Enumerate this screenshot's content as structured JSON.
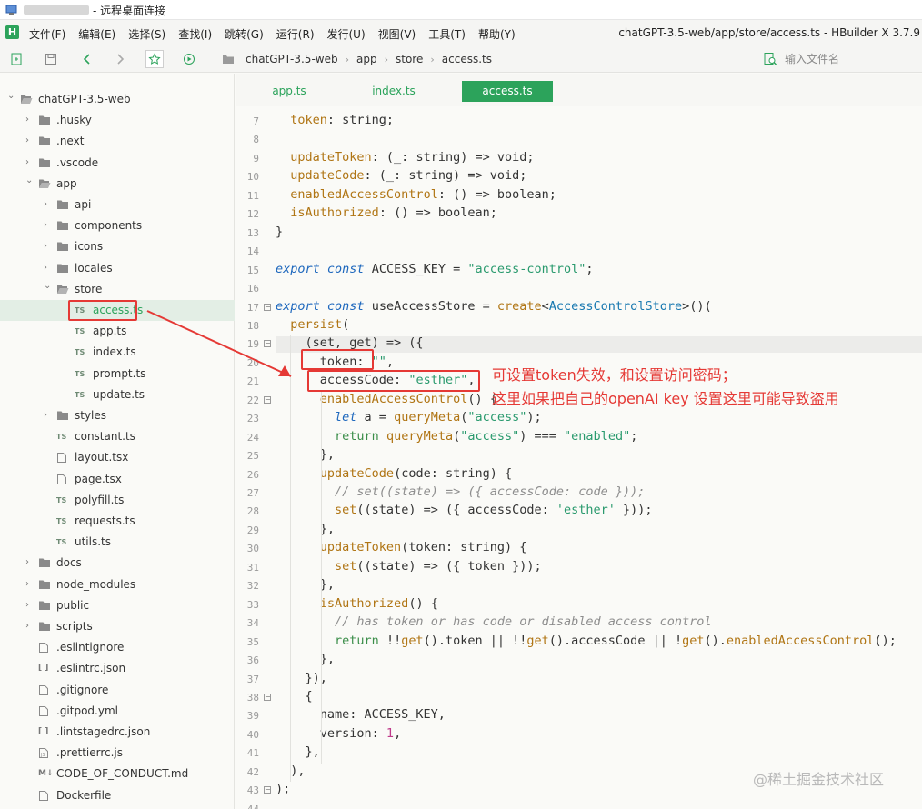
{
  "titlebar": {
    "title": "- 远程桌面连接"
  },
  "menubar": {
    "items": [
      "文件(F)",
      "编辑(E)",
      "选择(S)",
      "查找(I)",
      "跳转(G)",
      "运行(R)",
      "发行(U)",
      "视图(V)",
      "工具(T)",
      "帮助(Y)"
    ],
    "window_title": "chatGPT-3.5-web/app/store/access.ts - HBuilder X 3.7.9"
  },
  "toolbar": {
    "breadcrumb": [
      "chatGPT-3.5-web",
      "app",
      "store",
      "access.ts"
    ],
    "file_search_placeholder": "输入文件名"
  },
  "sidebar": {
    "items": [
      {
        "label": "chatGPT-3.5-web",
        "kind": "root",
        "icon": "folder-open-icon"
      },
      {
        "label": ".husky",
        "kind": "folder",
        "icon": "folder-icon"
      },
      {
        "label": ".next",
        "kind": "folder",
        "icon": "folder-icon"
      },
      {
        "label": ".vscode",
        "kind": "folder",
        "icon": "folder-icon"
      },
      {
        "label": "app",
        "kind": "folder-open",
        "icon": "folder-open-icon"
      },
      {
        "label": "api",
        "kind": "folder",
        "icon": "folder-icon"
      },
      {
        "label": "components",
        "kind": "folder",
        "icon": "folder-icon"
      },
      {
        "label": "icons",
        "kind": "folder",
        "icon": "folder-icon"
      },
      {
        "label": "locales",
        "kind": "folder",
        "icon": "folder-icon"
      },
      {
        "label": "store",
        "kind": "folder-open",
        "icon": "folder-open-icon"
      },
      {
        "label": "access.ts",
        "kind": "ts",
        "icon": "typescript-file-icon",
        "selected": true
      },
      {
        "label": "app.ts",
        "kind": "ts",
        "icon": "typescript-file-icon"
      },
      {
        "label": "index.ts",
        "kind": "ts",
        "icon": "typescript-file-icon"
      },
      {
        "label": "prompt.ts",
        "kind": "ts",
        "icon": "typescript-file-icon"
      },
      {
        "label": "update.ts",
        "kind": "ts",
        "icon": "typescript-file-icon"
      },
      {
        "label": "styles",
        "kind": "folder",
        "icon": "folder-icon"
      },
      {
        "label": "constant.ts",
        "kind": "ts",
        "icon": "typescript-file-icon"
      },
      {
        "label": "layout.tsx",
        "kind": "file",
        "icon": "file-icon"
      },
      {
        "label": "page.tsx",
        "kind": "file",
        "icon": "file-icon"
      },
      {
        "label": "polyfill.ts",
        "kind": "ts",
        "icon": "typescript-file-icon"
      },
      {
        "label": "requests.ts",
        "kind": "ts",
        "icon": "typescript-file-icon"
      },
      {
        "label": "utils.ts",
        "kind": "ts",
        "icon": "typescript-file-icon"
      },
      {
        "label": "docs",
        "kind": "folder",
        "icon": "folder-icon"
      },
      {
        "label": "node_modules",
        "kind": "folder",
        "icon": "folder-icon"
      },
      {
        "label": "public",
        "kind": "folder",
        "icon": "folder-icon"
      },
      {
        "label": "scripts",
        "kind": "folder",
        "icon": "folder-icon"
      },
      {
        "label": ".eslintignore",
        "kind": "file",
        "icon": "file-icon"
      },
      {
        "label": ".eslintrc.json",
        "kind": "json",
        "icon": "json-file-icon"
      },
      {
        "label": ".gitignore",
        "kind": "file",
        "icon": "file-icon"
      },
      {
        "label": ".gitpod.yml",
        "kind": "file",
        "icon": "file-icon"
      },
      {
        "label": ".lintstagedrc.json",
        "kind": "json",
        "icon": "json-file-icon"
      },
      {
        "label": ".prettierrc.js",
        "kind": "js",
        "icon": "js-file-icon"
      },
      {
        "label": "CODE_OF_CONDUCT.md",
        "kind": "md",
        "icon": "markdown-file-icon"
      },
      {
        "label": "Dockerfile",
        "kind": "file",
        "icon": "file-icon"
      }
    ]
  },
  "tabs": [
    {
      "label": "app.ts",
      "active": false
    },
    {
      "label": "index.ts",
      "active": false
    },
    {
      "label": "access.ts",
      "active": true
    }
  ],
  "editor": {
    "lines": [
      {
        "n": "7",
        "segs": [
          [
            "  ",
            ""
          ],
          [
            "token",
            "prop"
          ],
          [
            ": string;",
            ""
          ]
        ]
      },
      {
        "n": "8",
        "segs": []
      },
      {
        "n": "9",
        "segs": [
          [
            "  ",
            ""
          ],
          [
            "updateToken",
            "prop"
          ],
          [
            ": (_: string) => void;",
            ""
          ]
        ]
      },
      {
        "n": "10",
        "segs": [
          [
            "  ",
            ""
          ],
          [
            "updateCode",
            "prop"
          ],
          [
            ": (_: string) => void;",
            ""
          ]
        ]
      },
      {
        "n": "11",
        "segs": [
          [
            "  ",
            ""
          ],
          [
            "enabledAccessControl",
            "prop"
          ],
          [
            ": () => boolean;",
            ""
          ]
        ]
      },
      {
        "n": "12",
        "segs": [
          [
            "  ",
            ""
          ],
          [
            "isAuthorized",
            "prop"
          ],
          [
            ": () => boolean;",
            ""
          ]
        ]
      },
      {
        "n": "13",
        "segs": [
          [
            "}",
            ""
          ]
        ]
      },
      {
        "n": "14",
        "segs": []
      },
      {
        "n": "15",
        "segs": [
          [
            "export ",
            "kw"
          ],
          [
            "const ",
            "kw"
          ],
          [
            "ACCESS_KEY = ",
            ""
          ],
          [
            "\"access-control\"",
            "str"
          ],
          [
            ";",
            ""
          ]
        ]
      },
      {
        "n": "16",
        "segs": []
      },
      {
        "n": "17",
        "segs": [
          [
            "export ",
            "kw"
          ],
          [
            "const ",
            "kw"
          ],
          [
            "useAccessStore = ",
            ""
          ],
          [
            "create",
            "prop"
          ],
          [
            "<",
            ""
          ],
          [
            "AccessControlStore",
            "typ"
          ],
          [
            ">()(",
            ""
          ]
        ],
        "fold": true
      },
      {
        "n": "18",
        "segs": [
          [
            "  ",
            ""
          ],
          [
            "persist",
            "prop"
          ],
          [
            "(",
            ""
          ]
        ]
      },
      {
        "n": "19",
        "segs": [
          [
            "    (set, get) => ({",
            ""
          ]
        ],
        "fold": true
      },
      {
        "n": "20",
        "segs": [
          [
            "      token: ",
            ""
          ],
          [
            "\"\"",
            "str"
          ],
          [
            ",",
            ""
          ]
        ]
      },
      {
        "n": "21",
        "segs": [
          [
            "      accessCode: ",
            ""
          ],
          [
            "\"esther\"",
            "str"
          ],
          [
            ",",
            ""
          ]
        ]
      },
      {
        "n": "22",
        "segs": [
          [
            "      ",
            ""
          ],
          [
            "enabledAccessControl",
            "prop"
          ],
          [
            "() {",
            ""
          ]
        ],
        "fold": true
      },
      {
        "n": "23",
        "segs": [
          [
            "        ",
            ""
          ],
          [
            "let ",
            "kw"
          ],
          [
            "a = ",
            ""
          ],
          [
            "queryMeta",
            "prop"
          ],
          [
            "(",
            ""
          ],
          [
            "\"access\"",
            "str"
          ],
          [
            ");",
            ""
          ]
        ]
      },
      {
        "n": "24",
        "segs": [
          [
            "        ",
            ""
          ],
          [
            "return ",
            "ret"
          ],
          [
            "queryMeta",
            "prop"
          ],
          [
            "(",
            ""
          ],
          [
            "\"access\"",
            "str"
          ],
          [
            ") === ",
            ""
          ],
          [
            "\"enabled\"",
            "str"
          ],
          [
            ";",
            ""
          ]
        ]
      },
      {
        "n": "25",
        "segs": [
          [
            "      },",
            ""
          ]
        ]
      },
      {
        "n": "26",
        "segs": [
          [
            "      ",
            ""
          ],
          [
            "updateCode",
            "prop"
          ],
          [
            "(code: string) {",
            ""
          ]
        ]
      },
      {
        "n": "27",
        "segs": [
          [
            "        ",
            ""
          ],
          [
            "// set((state) => ({ accessCode: code }));",
            "cm"
          ]
        ]
      },
      {
        "n": "28",
        "segs": [
          [
            "        ",
            ""
          ],
          [
            "set",
            "prop"
          ],
          [
            "((state) => ({ accessCode: ",
            ""
          ],
          [
            "'esther'",
            "str"
          ],
          [
            " }));",
            ""
          ]
        ]
      },
      {
        "n": "29",
        "segs": [
          [
            "      },",
            ""
          ]
        ]
      },
      {
        "n": "30",
        "segs": [
          [
            "      ",
            ""
          ],
          [
            "updateToken",
            "prop"
          ],
          [
            "(token: string) {",
            ""
          ]
        ]
      },
      {
        "n": "31",
        "segs": [
          [
            "        ",
            ""
          ],
          [
            "set",
            "prop"
          ],
          [
            "((state) => ({ token }));",
            ""
          ]
        ]
      },
      {
        "n": "32",
        "segs": [
          [
            "      },",
            ""
          ]
        ]
      },
      {
        "n": "33",
        "segs": [
          [
            "      ",
            ""
          ],
          [
            "isAuthorized",
            "prop"
          ],
          [
            "() {",
            ""
          ]
        ]
      },
      {
        "n": "34",
        "segs": [
          [
            "        ",
            ""
          ],
          [
            "// has token or has code or disabled access control",
            "cm"
          ]
        ]
      },
      {
        "n": "35",
        "segs": [
          [
            "        ",
            ""
          ],
          [
            "return ",
            "ret"
          ],
          [
            "!!",
            ""
          ],
          [
            "get",
            "prop"
          ],
          [
            "().token || !!",
            ""
          ],
          [
            "get",
            "prop"
          ],
          [
            "().accessCode || !",
            ""
          ],
          [
            "get",
            "prop"
          ],
          [
            "().",
            ""
          ],
          [
            "enabledAccessControl",
            "prop"
          ],
          [
            "();",
            ""
          ]
        ]
      },
      {
        "n": "36",
        "segs": [
          [
            "      },",
            ""
          ]
        ]
      },
      {
        "n": "37",
        "segs": [
          [
            "    }),",
            ""
          ]
        ]
      },
      {
        "n": "38",
        "segs": [
          [
            "    {",
            ""
          ]
        ],
        "fold": true
      },
      {
        "n": "39",
        "segs": [
          [
            "      name: ACCESS_KEY,",
            ""
          ]
        ]
      },
      {
        "n": "40",
        "segs": [
          [
            "      version: ",
            ""
          ],
          [
            "1",
            "num"
          ],
          [
            ",",
            ""
          ]
        ]
      },
      {
        "n": "41",
        "segs": [
          [
            "    },",
            ""
          ]
        ]
      },
      {
        "n": "42",
        "segs": [
          [
            "  ),",
            ""
          ]
        ]
      },
      {
        "n": "43",
        "segs": [
          [
            ");",
            ""
          ]
        ],
        "fold": true
      },
      {
        "n": "44",
        "segs": []
      }
    ]
  },
  "annotation": {
    "line1": "可设置token失效，和设置访问密码；",
    "line2": "这里如果把自己的openAI key 设置这里可能导致盗用",
    "color": "#e53935"
  },
  "watermark": "@稀土掘金技术社区",
  "colors": {
    "accent": "#2ca35b",
    "annotation_red": "#e53935"
  }
}
